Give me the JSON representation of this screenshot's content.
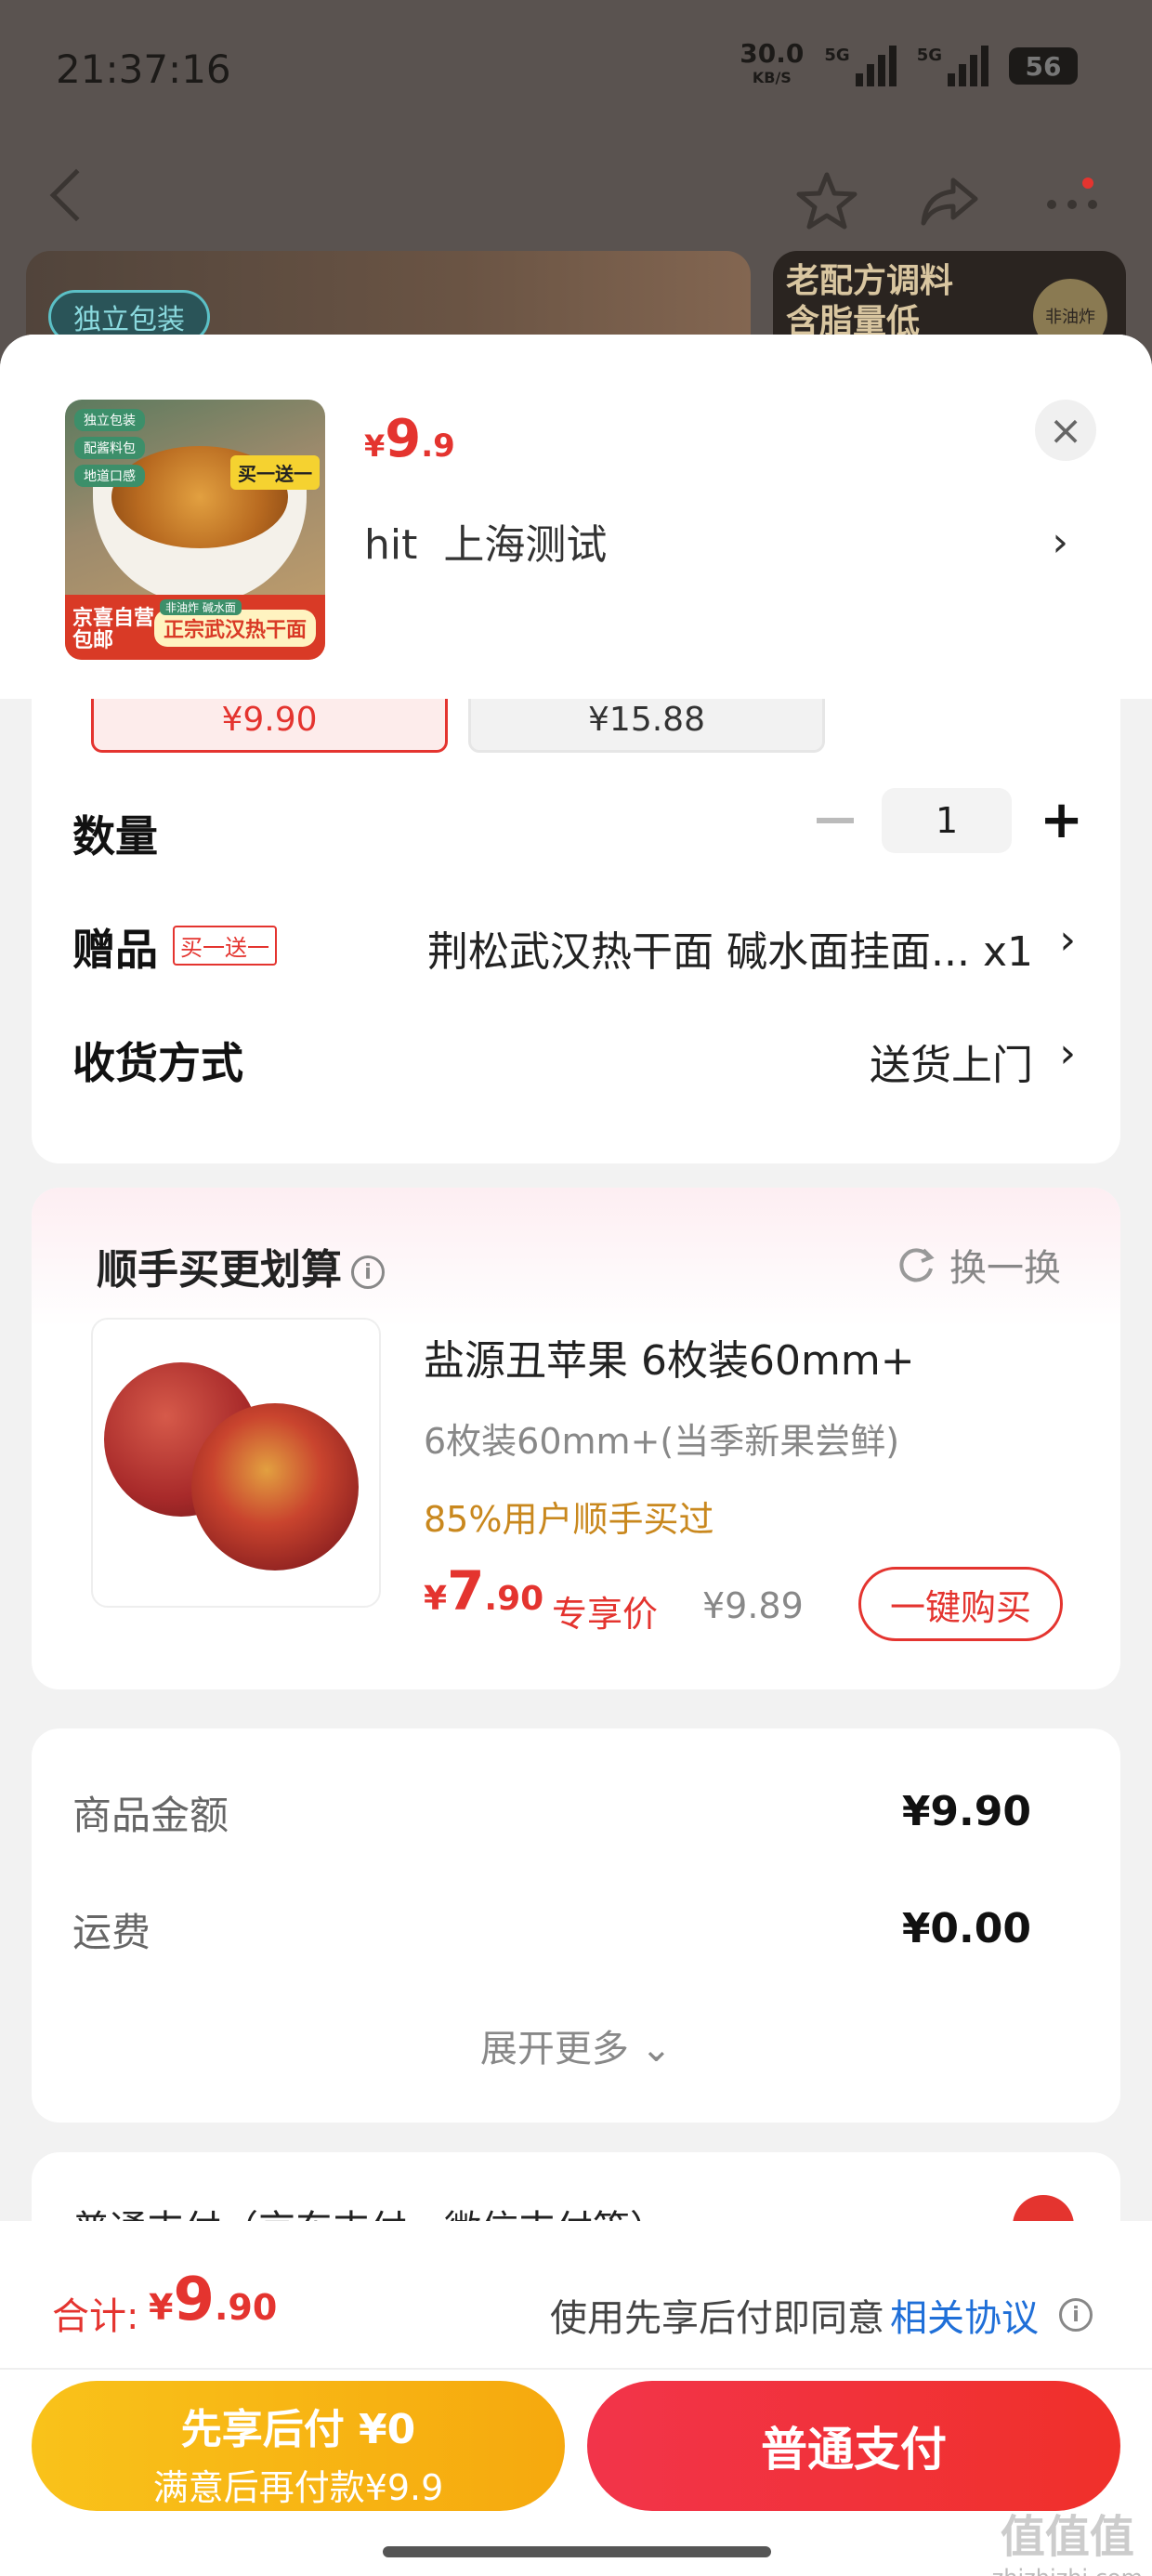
{
  "status": {
    "time": "21:37:16",
    "speed": "30.0",
    "speed_unit": "KB/S",
    "net1": "5G",
    "net2": "5G",
    "battery": "56"
  },
  "banner": {
    "tag": "独立包装",
    "right_text": "老配方调料\n含脂量低",
    "seal": "非油炸"
  },
  "sheet": {
    "thumb": {
      "tags": [
        "独立包装",
        "配酱料包",
        "地道口感"
      ],
      "badge": "买一送一",
      "foot_left": "京喜自营\n包邮",
      "foot_mid": "非油炸 碱水面",
      "foot_right": "正宗武汉热干面"
    },
    "price": {
      "yen": "¥",
      "int": "9",
      "dec": ".9"
    },
    "address": "hit  上海测试",
    "close": "×"
  },
  "options": {
    "selected": "¥9.90",
    "other": "¥15.88"
  },
  "quantity": {
    "label": "数量",
    "value": "1",
    "minus": "−",
    "plus": "+"
  },
  "gift": {
    "label": "赠品",
    "tag": "买一送一",
    "value": "荆松武汉热干面 碱水面挂面... x1"
  },
  "delivery": {
    "label": "收货方式",
    "value": "送货上门"
  },
  "recommend": {
    "title": "顺手买更划算",
    "swap": "换一换",
    "name": "盐源丑苹果 6枚装60mm+",
    "sub": "6枚装60mm+(当季新果尝鲜)",
    "hint": "85%用户顺手买过",
    "price": {
      "yen": "¥",
      "int": "7",
      "dec": ".90"
    },
    "exclusive": "专享价",
    "original": "¥9.89",
    "buy": "一键购买"
  },
  "summary": {
    "goods_label": "商品金额",
    "goods_value": "¥9.90",
    "ship_label": "运费",
    "ship_value": "¥0.00",
    "more": "展开更多 ⌄"
  },
  "payment_peek": "普通支付（京东支付、微信支付等）",
  "bottom": {
    "total_label": "合计:",
    "total_price": {
      "yen": "¥",
      "int": "9",
      "dec": ".90"
    },
    "agree_text": "使用先享后付即同意",
    "agree_link": "相关协议",
    "later_line1": "先享后付 ¥0",
    "later_line2": "满意后再付款¥9.9",
    "pay": "普通支付"
  },
  "watermark": {
    "mark": "值值值",
    "site": "zhizhizhi.com"
  },
  "colors": {
    "accent": "#e4342f",
    "gold": "#f6a90e",
    "link": "#1f6fd8"
  }
}
